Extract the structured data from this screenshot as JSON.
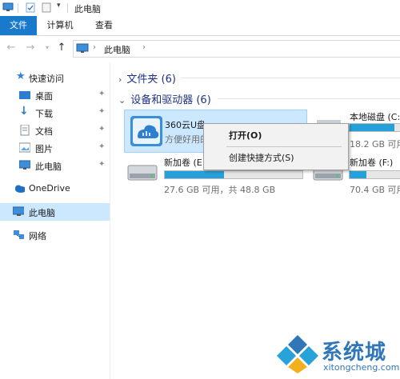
{
  "window": {
    "title": "此电脑"
  },
  "ribbon": {
    "tabs": [
      "文件",
      "计算机",
      "查看"
    ]
  },
  "address": {
    "path": "此电脑"
  },
  "nav": {
    "quick_access": "快速访问",
    "items": [
      {
        "label": "桌面",
        "icon": "desktop-icon"
      },
      {
        "label": "下载",
        "icon": "download-icon"
      },
      {
        "label": "文档",
        "icon": "document-icon"
      },
      {
        "label": "图片",
        "icon": "picture-icon"
      },
      {
        "label": "此电脑",
        "icon": "computer-icon"
      }
    ],
    "onedrive": "OneDrive",
    "this_pc": "此电脑",
    "network": "网络"
  },
  "content": {
    "folders_group": "文件夹 (6)",
    "devices_group": "设备和驱动器 (6)",
    "drives": [
      {
        "name": "360云U盘",
        "detail": "方便好用的",
        "usage": null
      },
      {
        "name": "本地磁盘 (C:",
        "size": "18.2 GB 可用，",
        "usage": 0.8
      },
      {
        "name": "新加卷 (E",
        "size": "27.6 GB 可用，共 48.8 GB",
        "usage": 0.43
      },
      {
        "name": "新加卷 (F:)",
        "size": "70.4 GB 可用，",
        "usage": 0.3
      }
    ]
  },
  "context_menu": {
    "items": [
      "打开(O)",
      "创建快捷方式(S)"
    ]
  },
  "watermark": {
    "brand": "系统城",
    "url": "xitongcheng.com"
  },
  "colors": {
    "accent": "#1979ca",
    "selection": "#cce8ff",
    "bar_fill": "#26a0da",
    "group_header": "#1e3287"
  }
}
